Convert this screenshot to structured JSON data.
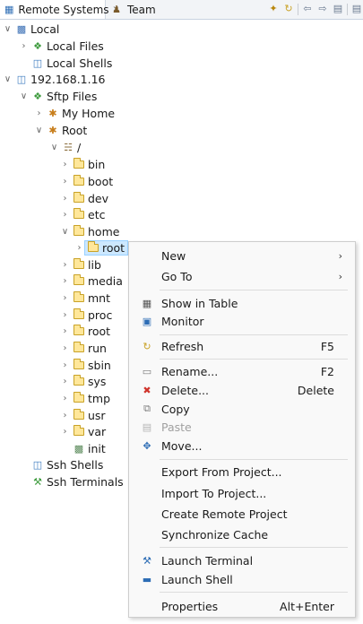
{
  "tabs": {
    "active": {
      "label": "Remote Systems"
    },
    "inactive": {
      "label": "Team"
    }
  },
  "tree": {
    "local": "Local",
    "local_files": "Local Files",
    "local_shells": "Local Shells",
    "host": "192.168.1.16",
    "sftp_files": "Sftp Files",
    "my_home": "My Home",
    "root_filter": "Root",
    "slash": "/",
    "dirs": [
      "bin",
      "boot",
      "dev",
      "etc",
      "home"
    ],
    "home_child": "root",
    "dirs2": [
      "lib",
      "media",
      "mnt",
      "proc",
      "root",
      "run",
      "sbin",
      "sys",
      "tmp",
      "usr",
      "var"
    ],
    "init": "init",
    "ssh_shells": "Ssh Shells",
    "ssh_terminals": "Ssh Terminals"
  },
  "menu": {
    "new": "New",
    "go_to": "Go To",
    "show_in_table": "Show in Table",
    "monitor": "Monitor",
    "refresh": "Refresh",
    "refresh_sc": "F5",
    "rename": "Rename...",
    "rename_sc": "F2",
    "delete": "Delete...",
    "delete_sc": "Delete",
    "copy": "Copy",
    "paste": "Paste",
    "move": "Move...",
    "export_from_project": "Export From Project...",
    "import_to_project": "Import To Project...",
    "create_remote_project": "Create Remote Project",
    "synchronize_cache": "Synchronize Cache",
    "launch_terminal": "Launch Terminal",
    "launch_shell": "Launch Shell",
    "properties": "Properties",
    "properties_sc": "Alt+Enter"
  },
  "colors": {
    "selection": "#cce8ff",
    "folder": "#ffe79a",
    "delete_icon": "#d0342c"
  }
}
